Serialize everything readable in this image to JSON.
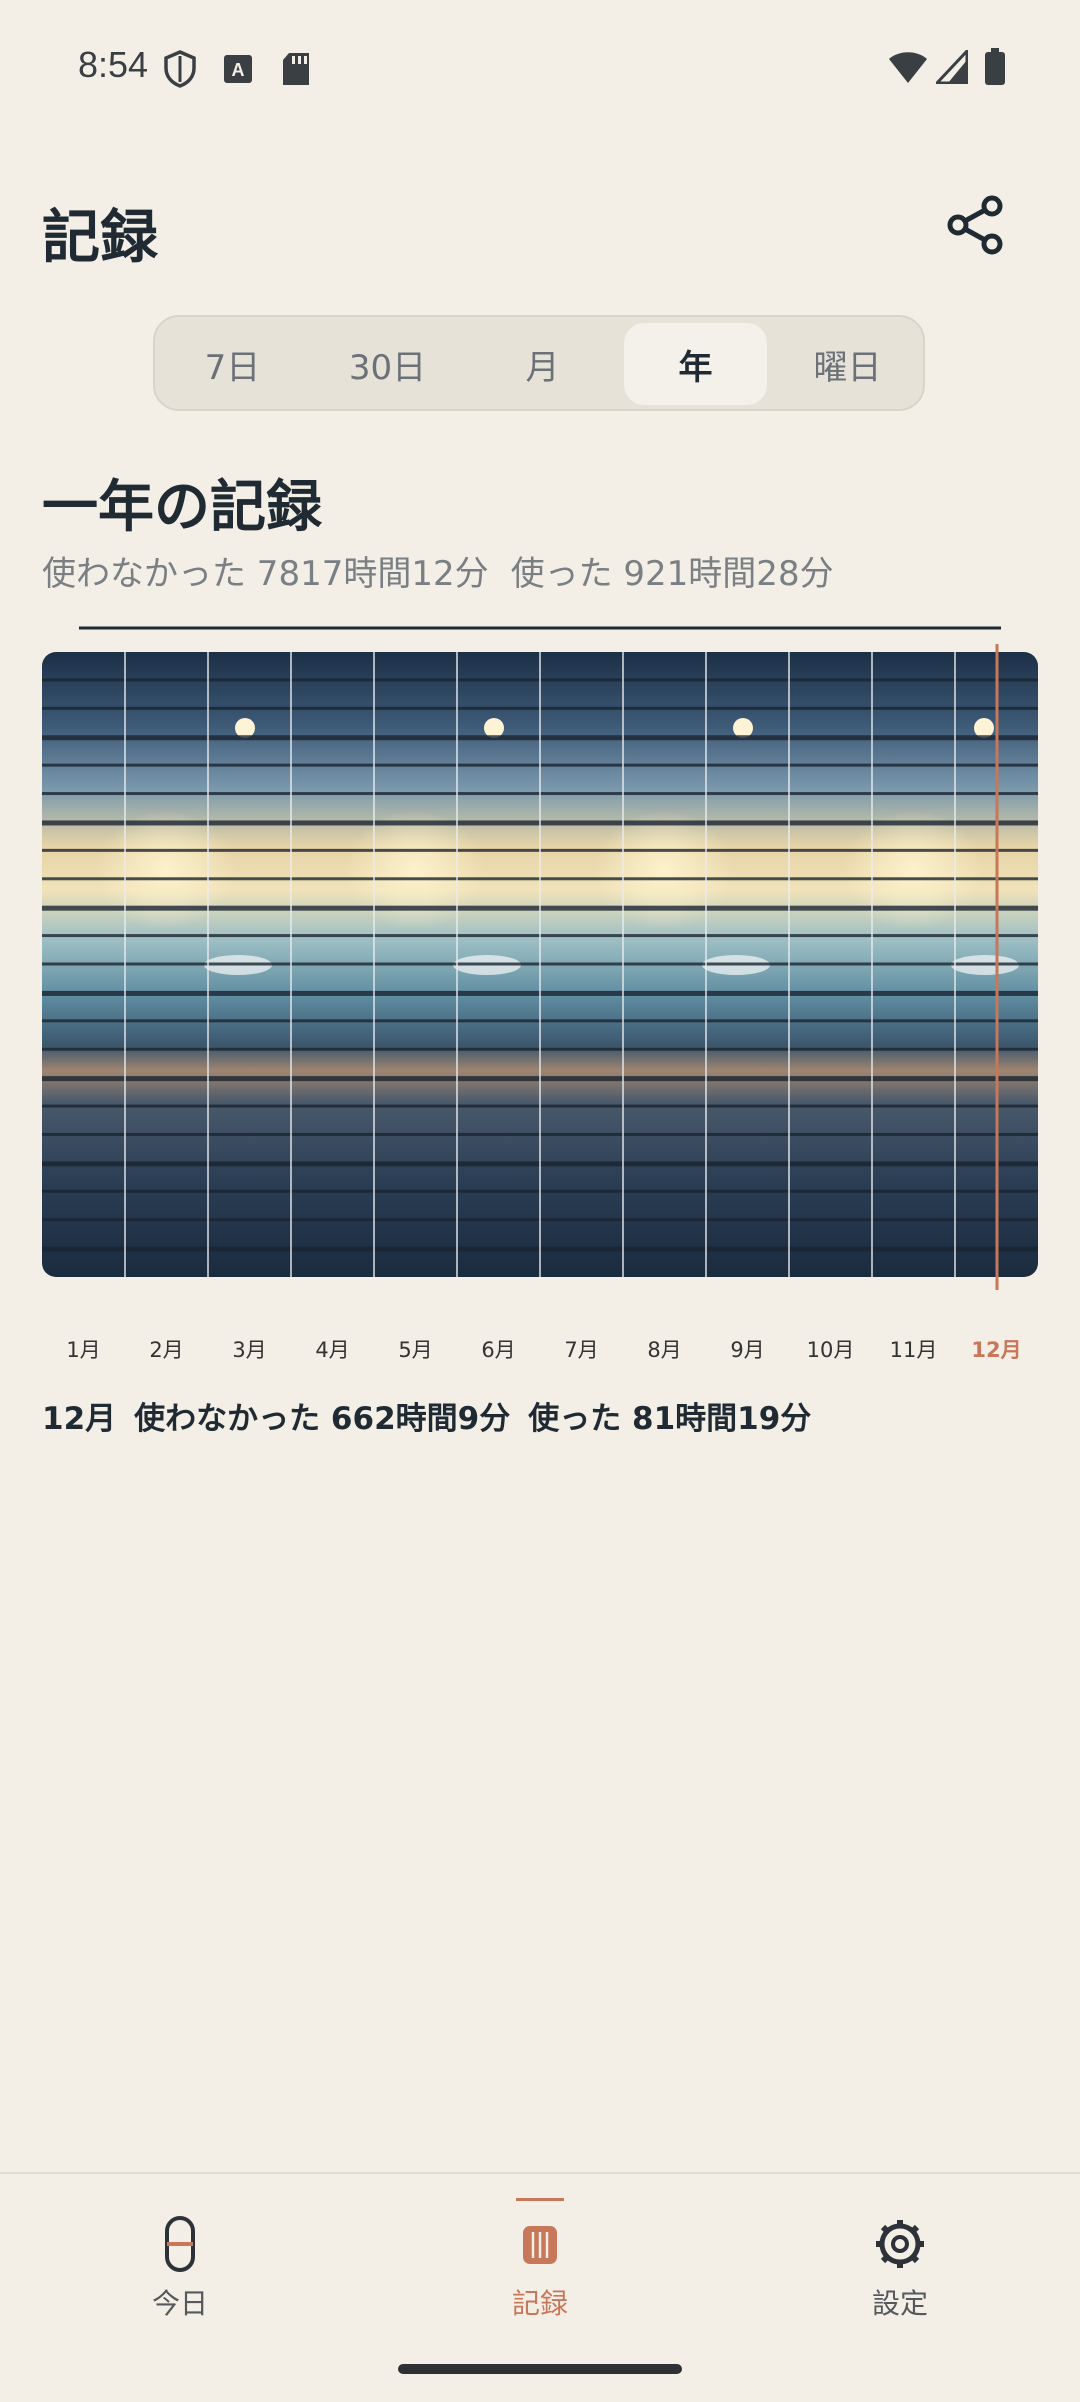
{
  "status_bar": {
    "time": "8:54",
    "left_icons": [
      "shield-icon",
      "keyboard-a-icon",
      "sd-card-icon"
    ],
    "right_icons": [
      "wifi-icon",
      "signal-icon",
      "battery-icon"
    ]
  },
  "header": {
    "title": "記録",
    "share_icon": "share-icon"
  },
  "tabs": [
    {
      "label": "7日",
      "active": false
    },
    {
      "label": "30日",
      "active": false
    },
    {
      "label": "月",
      "active": false
    },
    {
      "label": "年",
      "active": true
    },
    {
      "label": "曜日",
      "active": false
    }
  ],
  "section": {
    "title": "一年の記録",
    "unused": "使わなかった 7817時間12分",
    "used": "使った 921時間28分"
  },
  "chart_data": {
    "type": "bar",
    "categories": [
      "1月",
      "2月",
      "3月",
      "4月",
      "5月",
      "6月",
      "7月",
      "8月",
      "9月",
      "10月",
      "11月",
      "12月"
    ],
    "highlighted_category": "12月",
    "accent_color": "#c7775a"
  },
  "detail": {
    "month": "12月",
    "unused": "使わなかった 662時間9分",
    "used": "使った 81時間19分"
  },
  "bottom_nav": [
    {
      "label": "今日",
      "icon": "hourglass-icon",
      "active": false
    },
    {
      "label": "記録",
      "icon": "records-icon",
      "active": true
    },
    {
      "label": "設定",
      "icon": "gear-icon",
      "active": false
    }
  ],
  "colors": {
    "background": "#f3efe6",
    "accent": "#c7775a",
    "text": "#1f2a33"
  }
}
